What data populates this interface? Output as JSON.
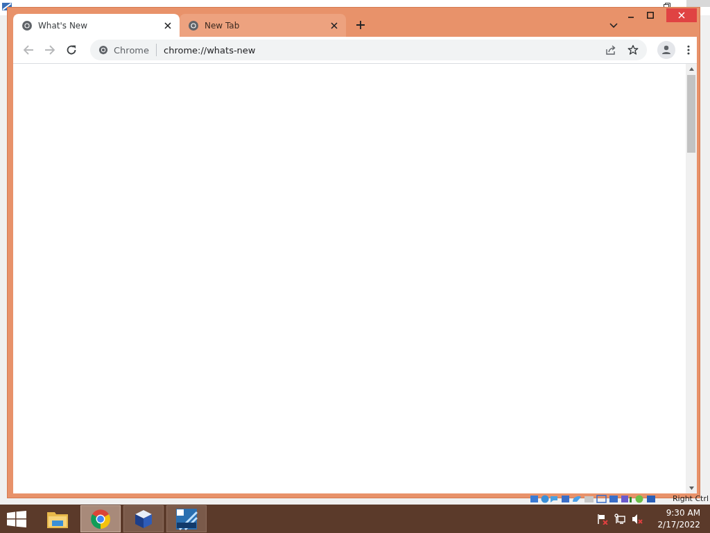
{
  "browser": {
    "tabs": [
      {
        "title": "What's New",
        "selected": true
      },
      {
        "title": "New Tab",
        "selected": false
      }
    ],
    "nav": [
      {
        "kind": "back",
        "disabled": true
      },
      {
        "kind": "forward",
        "disabled": true
      },
      {
        "kind": "reload",
        "disabled": false
      }
    ],
    "omnibox": {
      "chip": "Chrome",
      "url": "chrome://whats-new"
    }
  },
  "vm_status_bar": {
    "host_key": "Right Ctrl"
  },
  "taskbar": {
    "apps": [
      {
        "kind": "explorer",
        "running": false,
        "selected": false
      },
      {
        "kind": "chrome",
        "running": true,
        "selected": true
      },
      {
        "kind": "virtualbox",
        "running": true,
        "selected": false
      },
      {
        "kind": "vista",
        "running": true,
        "selected": false
      }
    ],
    "clock": {
      "time": "9:30 AM",
      "date": "2/17/2022"
    }
  }
}
